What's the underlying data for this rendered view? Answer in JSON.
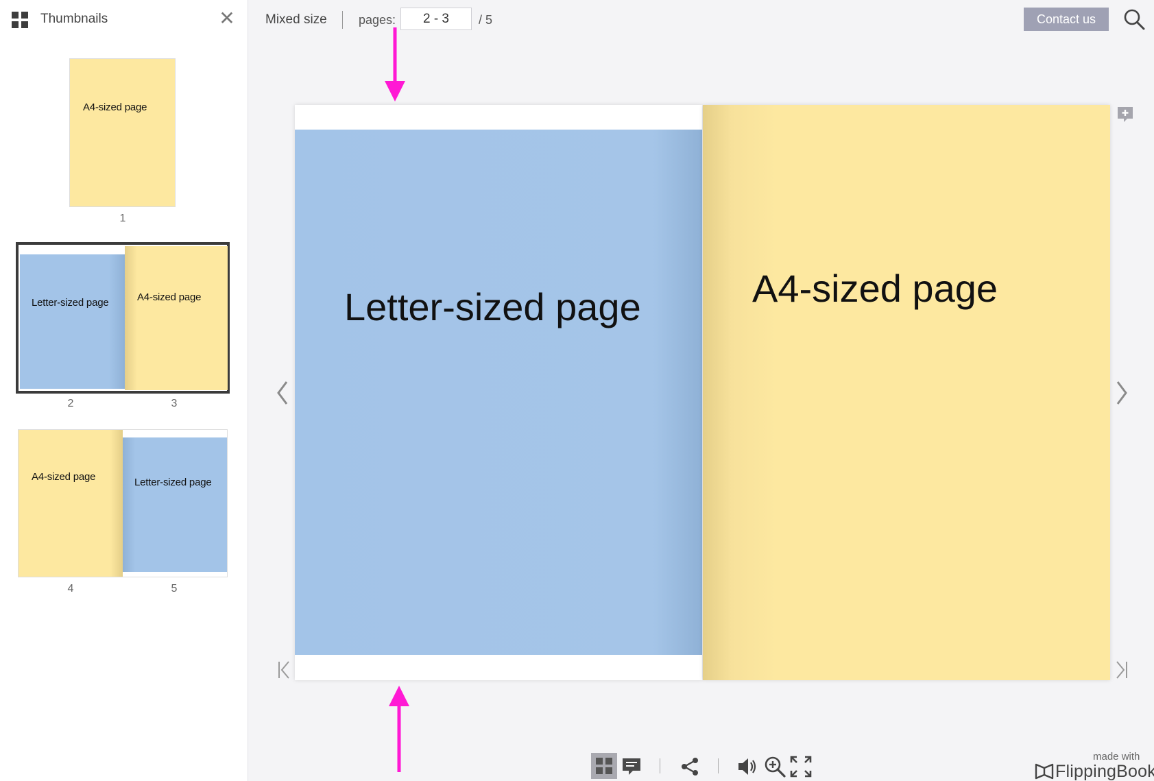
{
  "sidebar": {
    "title": "Thumbnails",
    "close_label": "✕",
    "thumbnails": [
      {
        "page": "1",
        "label": "A4-sized page"
      },
      {
        "page": "2",
        "label": "Letter-sized page"
      },
      {
        "page": "3",
        "label": "A4-sized page"
      },
      {
        "page": "4",
        "label": "A4-sized page"
      },
      {
        "page": "5",
        "label": "Letter-sized page"
      }
    ]
  },
  "toolbar": {
    "doc_title": "Mixed size",
    "pages_label": "pages:",
    "pages_value": "2 - 3",
    "pages_total": "/ 5",
    "contact_label": "Contact us"
  },
  "book": {
    "left_page_text": "Letter-sized page",
    "right_page_text": "A4-sized page"
  },
  "branding": {
    "made_with": "made with",
    "name": "FlippingBook"
  },
  "colors": {
    "letter_page": "#a3c4e8",
    "a4_page": "#fde8a0",
    "annotation_arrow": "#ff19d4",
    "contact_button": "#9fa1b4"
  }
}
